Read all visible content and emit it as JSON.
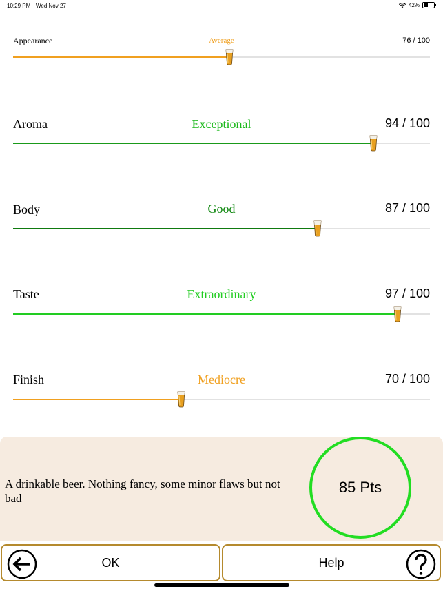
{
  "status_bar": {
    "time": "10:29 PM",
    "date": "Wed Nov 27",
    "battery": "42%",
    "battery_level": 0.42
  },
  "ratings": [
    {
      "name": "Appearance",
      "word": "Average",
      "score": "76 / 100",
      "value": 76,
      "color": "#f0a020",
      "fill_color": "#f0a020"
    },
    {
      "name": "Aroma",
      "word": "Exceptional",
      "score": "94 / 100",
      "value": 94,
      "color": "#1bb81b",
      "fill_color": "#1a9a1a"
    },
    {
      "name": "Body",
      "word": "Good",
      "score": "87 / 100",
      "value": 87,
      "color": "#118811",
      "fill_color": "#0f7a0f"
    },
    {
      "name": "Taste",
      "word": "Extraordinary",
      "score": "97 / 100",
      "value": 97,
      "color": "#22cc22",
      "fill_color": "#22cc22"
    },
    {
      "name": "Finish",
      "word": "Mediocre",
      "score": "70 / 100",
      "value": 70,
      "color": "#f0a020",
      "fill_color": "#f0a020"
    }
  ],
  "summary": {
    "text": "A drinkable beer. Nothing fancy, some minor flaws but not bad",
    "points": "85 Pts",
    "ring_color": "#22dd22"
  },
  "buttons": {
    "ok": "OK",
    "help": "Help"
  },
  "icons": {
    "back": "arrow-left-icon",
    "help": "question-mark-icon",
    "thumb": "beer-glass-icon"
  }
}
